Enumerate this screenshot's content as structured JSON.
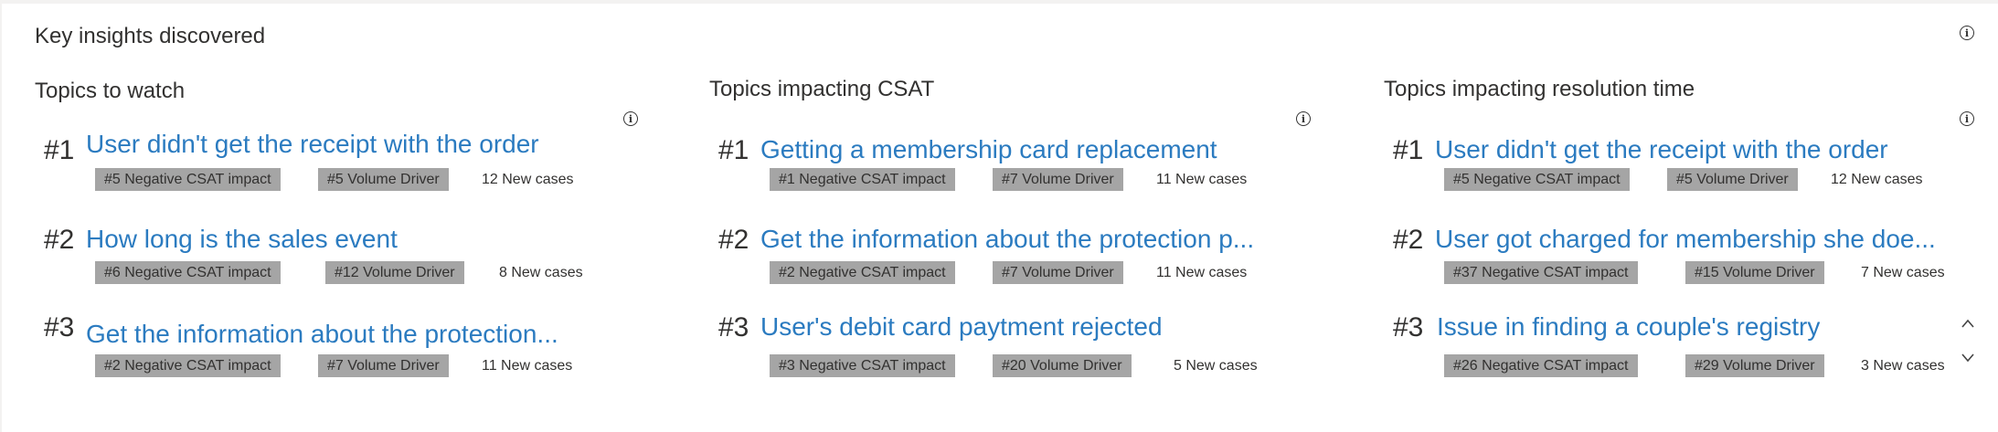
{
  "panel": {
    "title": "Key insights discovered",
    "info_icon": "info-icon"
  },
  "columns": [
    {
      "title": "Topics to watch",
      "items": [
        {
          "rank": "#1",
          "topic": "User didn't get the receipt with the order",
          "csat_tag": "#5 Negative CSAT impact",
          "volume_tag": "#5 Volume Driver",
          "new_cases": "12 New cases"
        },
        {
          "rank": "#2",
          "topic": "How long is the sales event",
          "csat_tag": "#6 Negative CSAT impact",
          "volume_tag": "#12 Volume Driver",
          "new_cases": "8 New cases"
        },
        {
          "rank": "#3",
          "topic": "Get the information about the protection...",
          "csat_tag": "#2 Negative CSAT impact",
          "volume_tag": "#7 Volume Driver",
          "new_cases": "11 New cases"
        }
      ]
    },
    {
      "title": "Topics impacting CSAT",
      "items": [
        {
          "rank": "#1",
          "topic": "Getting a membership card replacement",
          "csat_tag": "#1 Negative CSAT impact",
          "volume_tag": "#7 Volume Driver",
          "new_cases": "11 New cases"
        },
        {
          "rank": "#2",
          "topic": "Get the information about the protection p...",
          "csat_tag": "#2 Negative CSAT impact",
          "volume_tag": "#7 Volume Driver",
          "new_cases": "11 New cases"
        },
        {
          "rank": "#3",
          "topic": "User's debit card paytment rejected",
          "csat_tag": "#3 Negative CSAT impact",
          "volume_tag": "#20 Volume Driver",
          "new_cases": "5 New cases"
        }
      ]
    },
    {
      "title": "Topics impacting resolution time",
      "items": [
        {
          "rank": "#1",
          "topic": "User didn't get the receipt with the order",
          "csat_tag": "#5 Negative CSAT impact",
          "volume_tag": "#5 Volume Driver",
          "new_cases": "12 New cases"
        },
        {
          "rank": "#2",
          "topic": "User got charged for membership she doe...",
          "csat_tag": "#37 Negative CSAT impact",
          "volume_tag": "#15 Volume Driver",
          "new_cases": "7 New cases"
        },
        {
          "rank": "#3",
          "topic": "Issue in finding a couple's registry",
          "csat_tag": "#26 Negative CSAT impact",
          "volume_tag": "#29 Volume Driver",
          "new_cases": "3 New cases"
        }
      ]
    }
  ],
  "scroll": {
    "up_icon": "chevron-up-icon",
    "down_icon": "chevron-down-icon"
  }
}
